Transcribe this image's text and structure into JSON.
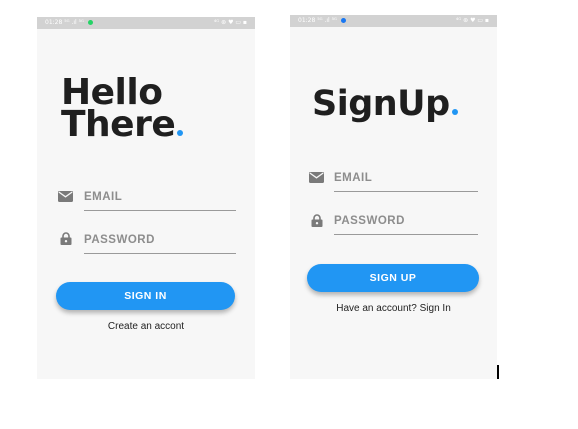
{
  "theme": {
    "accent": "#2196f3",
    "status_bar": "#d2d2d2",
    "screen_bg": "#f7f7f7",
    "text_dark": "#1f1f1f",
    "placeholder": "#8d8d8d",
    "icon_color": "#7a7a7a",
    "whatsapp_green": "#25d366",
    "facebook_blue": "#1877f2"
  },
  "signin_screen": {
    "status_bar": {
      "time": "01:28",
      "signals": "⁵ᴳ .ıl ⁵ᴳ",
      "right": "⁴ᴳ ⊛ ♥ ▭ ▪",
      "app_icon": "whatsapp-icon"
    },
    "headline_line1": "Hello",
    "headline_line2": "There",
    "email": {
      "icon": "mail-icon",
      "placeholder": "EMAIL"
    },
    "password": {
      "icon": "lock-icon",
      "placeholder": "PASSWORD"
    },
    "button_label": "SIGN IN",
    "create_account_link": "Create an accont"
  },
  "signup_screen": {
    "status_bar": {
      "time": "01:28",
      "signals": "⁵ᴳ .ıl ⁵ᴳ",
      "right": "⁴ᴳ ⊛ ♥ ▭ ▪",
      "app_icon": "facebook-icon"
    },
    "headline": "SignUp",
    "email": {
      "icon": "mail-icon",
      "placeholder": "EMAIL"
    },
    "password": {
      "icon": "lock-icon",
      "placeholder": "PASSWORD"
    },
    "button_label": "SIGN UP",
    "signin_link": "Have an account? Sign In"
  }
}
